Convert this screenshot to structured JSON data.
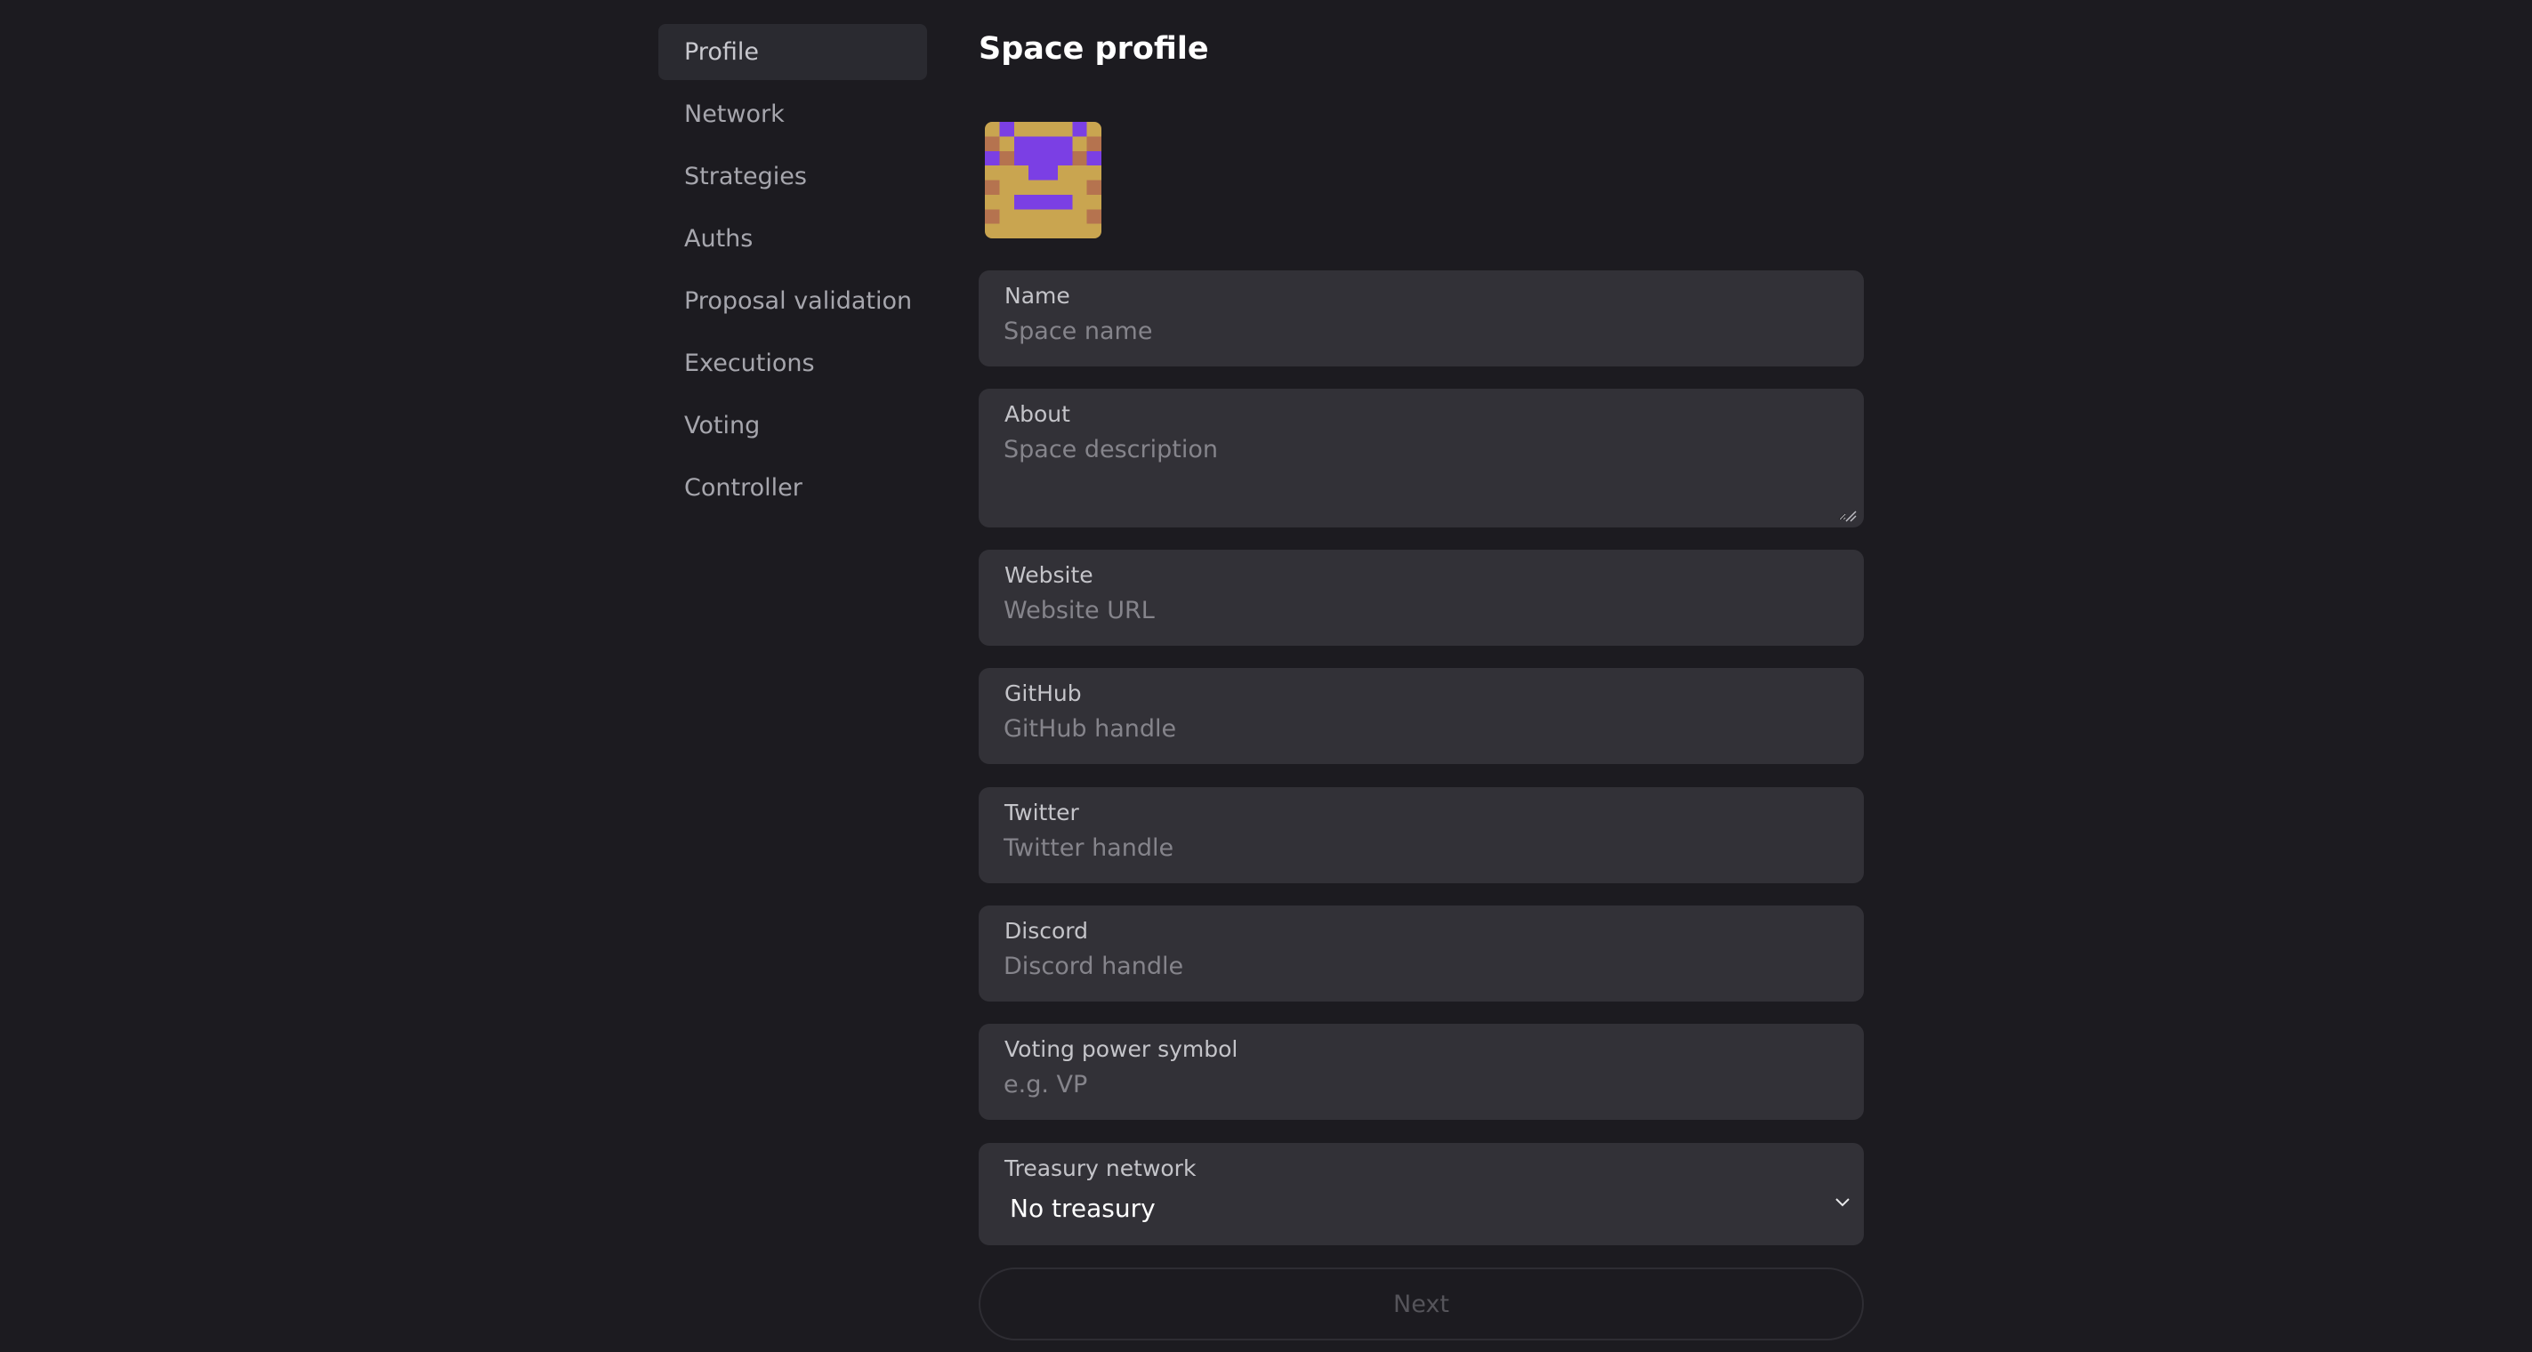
{
  "sidebar": {
    "items": [
      {
        "label": "Profile",
        "active": true
      },
      {
        "label": "Network"
      },
      {
        "label": "Strategies"
      },
      {
        "label": "Auths"
      },
      {
        "label": "Proposal validation"
      },
      {
        "label": "Executions"
      },
      {
        "label": "Voting"
      },
      {
        "label": "Controller"
      }
    ]
  },
  "main": {
    "title": "Space profile",
    "avatar": {
      "icon": "pixel-avatar",
      "colors": {
        "bg": "#c9a550",
        "accent": "#7b3fe4",
        "shade": "#b5734f"
      }
    },
    "fields": {
      "name": {
        "label": "Name",
        "placeholder": "Space name",
        "value": ""
      },
      "about": {
        "label": "About",
        "placeholder": "Space description",
        "value": ""
      },
      "website": {
        "label": "Website",
        "placeholder": "Website URL",
        "value": ""
      },
      "github": {
        "label": "GitHub",
        "placeholder": "GitHub handle",
        "value": ""
      },
      "twitter": {
        "label": "Twitter",
        "placeholder": "Twitter handle",
        "value": ""
      },
      "discord": {
        "label": "Discord",
        "placeholder": "Discord handle",
        "value": ""
      },
      "voting_power_symbol": {
        "label": "Voting power symbol",
        "placeholder": "e.g. VP",
        "value": ""
      },
      "treasury_network": {
        "label": "Treasury network",
        "selected": "No treasury"
      }
    },
    "next_label": "Next"
  }
}
